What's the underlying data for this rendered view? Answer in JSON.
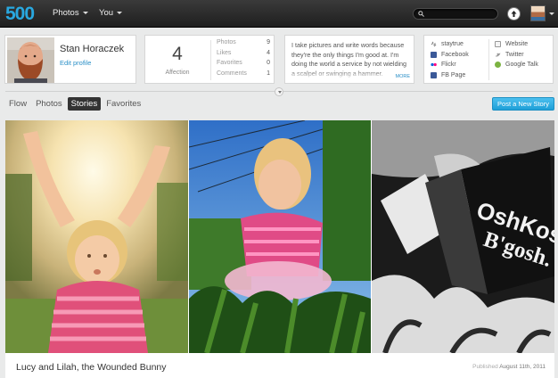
{
  "brand": {
    "logo_text": "500"
  },
  "nav": {
    "photos_label": "Photos",
    "you_label": "You"
  },
  "search": {
    "placeholder": ""
  },
  "icons": {
    "logo": "500px-logo",
    "search": "search-icon",
    "upload": "upload-arrow-icon",
    "expand": "chevron-down-icon",
    "staytrue": "link-icon",
    "facebook": "facebook-icon",
    "flickr": "flickr-icon",
    "fbpage": "facebook-page-icon",
    "website": "website-icon",
    "twitter": "twitter-icon",
    "googletalk": "google-talk-icon"
  },
  "colors": {
    "accent": "#2a8fc7",
    "post_button": "#29a8e0",
    "topbar": "#262626",
    "logo_blue": "#29a8e0"
  },
  "profile": {
    "name": "Stan Horaczek",
    "edit_link": "Edit profile"
  },
  "stats": {
    "affection_value": "4",
    "affection_label": "Affection",
    "rows": [
      {
        "label": "Photos",
        "value": "9"
      },
      {
        "label": "Likes",
        "value": "4"
      },
      {
        "label": "Favorites",
        "value": "0"
      },
      {
        "label": "Comments",
        "value": "1"
      }
    ]
  },
  "bio": {
    "text": "I take pictures and write words because they're the only things I'm good at. I'm doing the world a service by not wielding a scalpel or swinging a hammer.",
    "more_label": "MORE"
  },
  "links": {
    "left": [
      {
        "label": "staytrue"
      },
      {
        "label": "Facebook"
      },
      {
        "label": "Flickr"
      },
      {
        "label": "FB Page"
      }
    ],
    "right": [
      {
        "label": "Website"
      },
      {
        "label": "Twitter"
      },
      {
        "label": "Google Talk"
      }
    ]
  },
  "tabs": [
    {
      "label": "Flow"
    },
    {
      "label": "Photos"
    },
    {
      "label": "Stories",
      "active": true
    },
    {
      "label": "Favorites"
    }
  ],
  "post_button_label": "Post a New Story",
  "story": {
    "title": "Lucy and Lilah, the Wounded Bunny",
    "published_prefix": "Published",
    "published_date": "August 11th, 2011",
    "box_text_line1": "OshKos",
    "box_text_line2": "B'gosh."
  }
}
